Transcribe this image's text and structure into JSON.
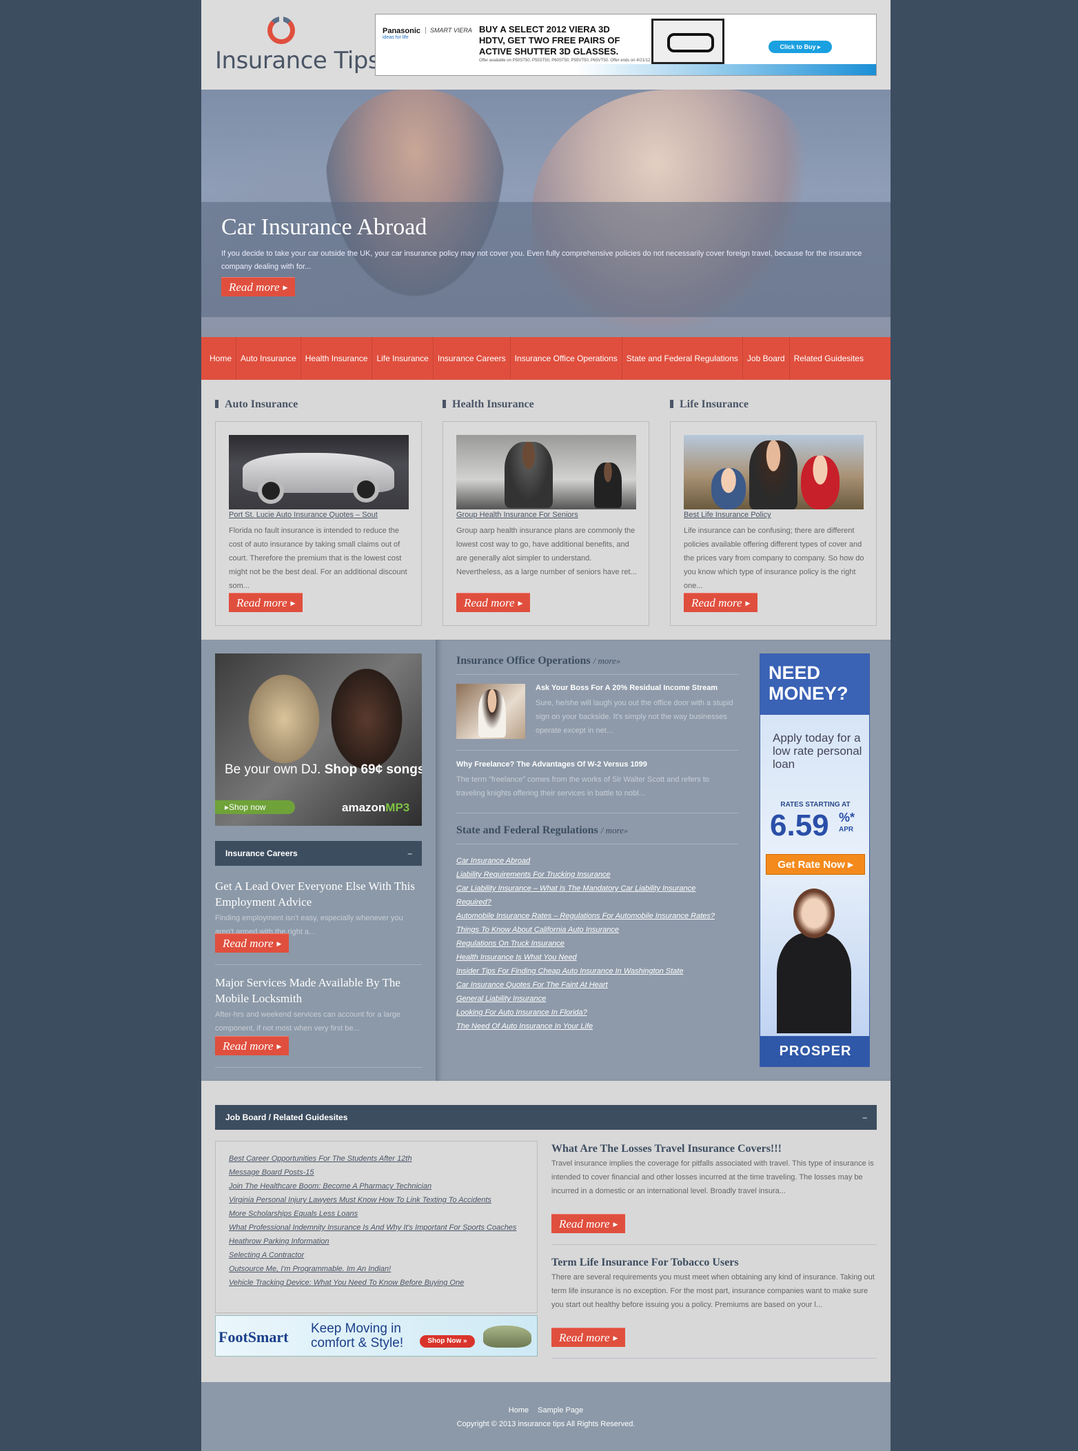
{
  "header": {
    "logo_text": "Insurance Tips",
    "ad": {
      "brand": "Panasonic",
      "brand_tagline": "ideas for life",
      "brand2": "SMART VIERA",
      "headline": "BUY A SELECT 2012 VIERA 3D HDTV, GET TWO FREE PAIRS OF ACTIVE SHUTTER 3D GLASSES.",
      "fine_print": "Offer available on P50ST50, P55ST50, P60ST50, P55VT50, P65VT50. Offer ends on 4/21/12",
      "cta": "Click to Buy"
    }
  },
  "hero": {
    "title": "Car Insurance Abroad",
    "text": "If you decide to take your car outside the UK, your car insurance policy may not cover you. Even fully comprehensive policies do not necessarily cover foreign travel, because for the insurance company dealing with for...",
    "button": "Read more"
  },
  "nav": [
    "Home",
    "Auto Insurance",
    "Health Insurance",
    "Life Insurance",
    "Insurance Careers",
    "Insurance Office Operations",
    "State and Federal Regulations",
    "Job Board",
    "Related Guidesites"
  ],
  "categories": [
    {
      "title": "Auto Insurance",
      "link": "Port St. Lucie Auto Insurance Quotes – Sout",
      "text": "Florida no fault insurance is intended to reduce the cost of auto insurance by taking small claims out of court. Therefore the premium that is the lowest cost might not be the best deal. For an additional discount som...",
      "button": "Read more"
    },
    {
      "title": "Health Insurance",
      "link": "Group Health Insurance For Seniors",
      "text": "Group aarp health insurance plans are commonly the lowest cost way to go, have additional benefits, and are generally alot simpler to understand. Nevertheless, as a large number of seniors have ret...",
      "button": "Read more"
    },
    {
      "title": "Life Insurance",
      "link": "Best Life Insurance Policy",
      "text": "Life insurance can be confusing; there are different policies available offering different types of cover and the prices vary from company to company. So how do you know which type of insurance policy is the right one...",
      "button": "Read more"
    }
  ],
  "amazon_ad": {
    "text_a": "Be your own DJ.",
    "text_b": "Shop 69¢ songs.",
    "shop": "Shop now",
    "logo_a": "amazon",
    "logo_b": "MP3"
  },
  "careers": {
    "widget_title": "Insurance Careers",
    "min": "–",
    "items": [
      {
        "title": "Get A Lead Over Everyone Else With This Employment Advice",
        "text": "Finding employment isn't easy, especially whenever you aren't armed with the right a...",
        "button": "Read more"
      },
      {
        "title": "Major Services Made Available By The Mobile Locksmith",
        "text": "After-hrs and weekend services can account for a large component, if not most when very first be...",
        "button": "Read more"
      }
    ]
  },
  "office_ops": {
    "title": "Insurance Office Operations",
    "more": "/ more»",
    "items": [
      {
        "title": "Ask Your Boss For A 20% Residual Income Stream",
        "text": "Sure, he/she will laugh you out the office door with a stupid sign on your backside. It's simply not the way businesses operate except in net..."
      },
      {
        "title": "Why Freelance? The Advantages Of W-2 Versus 1099",
        "text": "The term \"freelance\" comes from the works of Sir Walter Scott and refers to traveling knights offering their services in battle to nobl..."
      }
    ]
  },
  "regulations": {
    "title": "State and Federal Regulations",
    "more": "/ more»",
    "links": [
      "Car Insurance Abroad",
      "Liability Requirements For Trucking Insurance",
      "Car Liability Insurance – What Is The Mandatory Car Liability Insurance Required?",
      "Automobile Insurance Rates – Regulations For Automobile Insurance Rates?",
      "Things To Know About California Auto Insurance",
      "Regulations On Truck Insurance",
      "Health Insurance Is What You Need",
      "Insider Tips For Finding Cheap Auto Insurance In Washington State",
      "Car Insurance Quotes For The Faint At Heart",
      "General Liability Insurance",
      "Looking For Auto Insurance In Florida?",
      "The Need Of Auto Insurance In Your Life"
    ]
  },
  "prosper_ad": {
    "headline": "NEED MONEY?",
    "apply": "Apply today for a low rate personal loan",
    "rates_label": "RATES STARTING AT",
    "rate": "6.59",
    "percent": "%*",
    "apr": "APR",
    "cta": "Get Rate Now",
    "brand": "PROSPER"
  },
  "job_board": {
    "widget_title": "Job Board / Related Guidesites",
    "min": "–",
    "links": [
      "Best Career Opportunities For The Students After 12th",
      "Message Board Posts-15",
      "Join The Healthcare Boom: Become A Pharmacy Technician",
      "Virginia Personal Injury Lawyers Must Know How To Link Texting To Accidents",
      "More Scholarships Equals Less Loans",
      "What Professional Indemnity Insurance Is And Why It's Important For Sports Coaches",
      "Heathrow Parking Information",
      "Selecting A Contractor",
      "Outsource Me, I'm Programmable. Im An Indian!",
      "Vehicle Tracking Device: What You Need To Know Before Buying One"
    ],
    "posts": [
      {
        "title": "What Are The Losses Travel Insurance Covers!!!",
        "text": "Travel insurance implies the coverage for pitfalls associated with travel. This type of insurance is intended to cover financial and other losses incurred at the time traveling. The losses may be incurred in a domestic or an international level. Broadly travel insura...",
        "button": "Read more"
      },
      {
        "title": "Term Life Insurance For Tobacco Users",
        "text": "There are several requirements you must meet when obtaining any kind of insurance. Taking out term life insurance is no exception. For the most part, insurance companies want to make sure you start out healthy before issuing you a policy. Premiums are based on your l...",
        "button": "Read more"
      }
    ]
  },
  "footsmart_ad": {
    "logo": "FootSmart",
    "text": "Keep Moving in comfort & Style!",
    "cta": "Shop Now »"
  },
  "footer": {
    "links": [
      "Home",
      "Sample Page"
    ],
    "copyright": "Copyright © 2013 insurance tips All Rights Reserved."
  },
  "colors": {
    "accent": "#e04f3e",
    "dark": "#3d4d60",
    "band": "#8c99a8"
  }
}
